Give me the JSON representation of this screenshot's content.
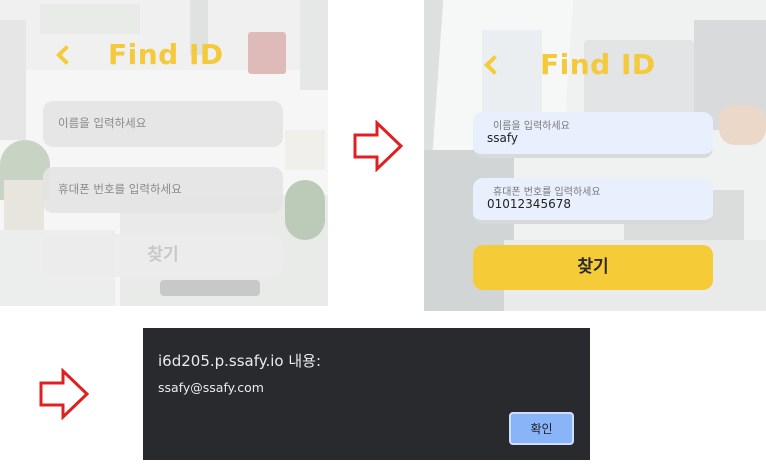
{
  "step1": {
    "title": "Find ID",
    "name_placeholder": "이름을 입력하세요",
    "phone_placeholder": "휴대폰 번호를 입력하세요",
    "submit_label": "찾기"
  },
  "step2": {
    "title": "Find ID",
    "name_label": "이름을 입력하세요",
    "name_value": "ssafy",
    "phone_label": "휴대폰 번호를 입력하세요",
    "phone_value": "01012345678",
    "submit_label": "찾기"
  },
  "alert": {
    "title": "i6d205.p.ssafy.io 내용:",
    "message": "ssafy@ssafy.com",
    "ok_label": "확인"
  },
  "colors": {
    "title_yellow": "#f4c93a",
    "button_yellow": "#f5cb38",
    "arrow_red": "#e02020",
    "dialog_bg": "#292a2d",
    "dialog_button": "#8ab4f8"
  },
  "icons": [
    "back-chevron-icon",
    "step-arrow-icon"
  ]
}
